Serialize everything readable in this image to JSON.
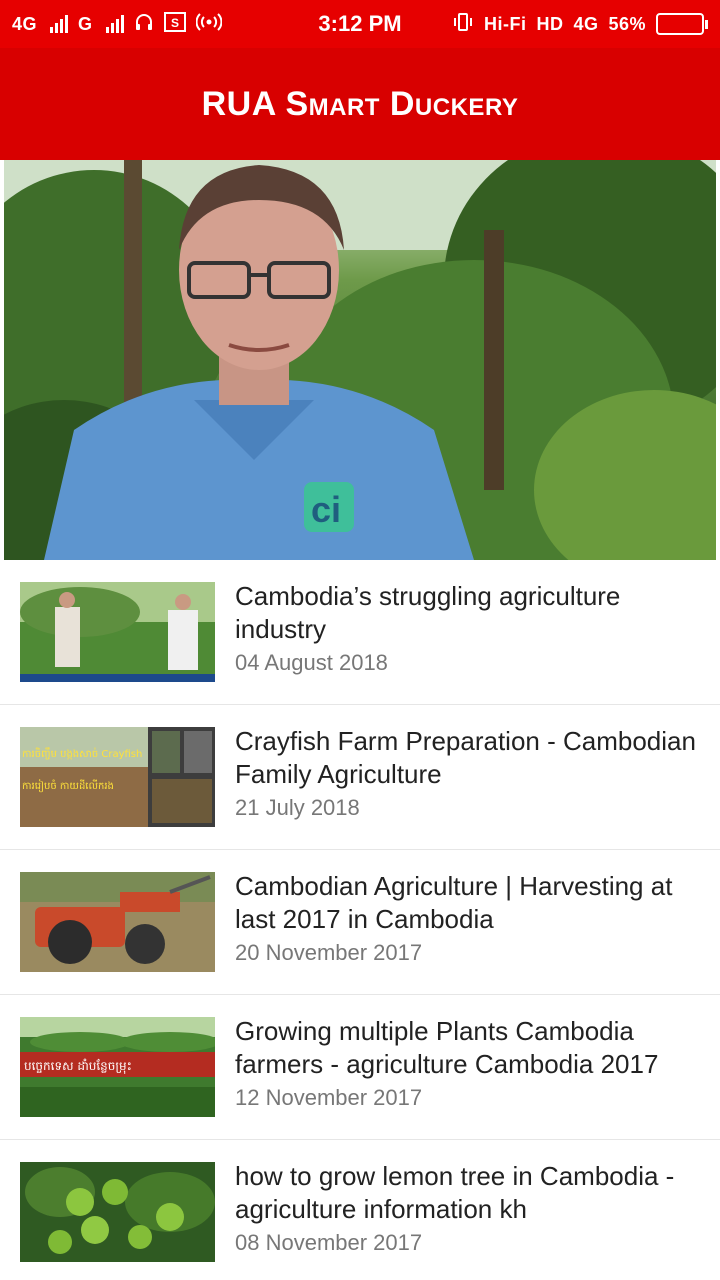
{
  "status_bar": {
    "left_network_1": "4G",
    "left_network_2": "G",
    "headphone_icon": "headphones-icon",
    "sim_icon": "sim-icon",
    "hotspot_icon": "hotspot-icon",
    "time": "3:12 PM",
    "vibrate_icon": "vibrate-icon",
    "hifi": "Hi-Fi",
    "hd": "HD",
    "right_network": "4G",
    "battery_text": "56%",
    "battery_level": 0.56
  },
  "app": {
    "title": "RUA Smart Duckery",
    "accent_color": "#d80000"
  },
  "video": {
    "logo_text": "ci"
  },
  "feed": {
    "items": [
      {
        "title": "Cambodia’s struggling agriculture industry",
        "date": "04 August 2018"
      },
      {
        "title": "Crayfish Farm Preparation - Cambodian Family Agriculture",
        "date": "21 July 2018",
        "thumb_text_1": "ការចិញ្ចឹម បង្កងសាច់ Crayfish",
        "thumb_text_2": "ការរៀបចំ កាយដីលើករង"
      },
      {
        "title": "Cambodian Agriculture | Harvesting at last 2017 in Cambodia",
        "date": "20 November 2017"
      },
      {
        "title": "Growing multiple Plants Cambodia farmers - agriculture Cambodia 2017",
        "date": "12 November 2017",
        "thumb_text_1": "បច្ចេកទេស ដាំបន្លែចម្រុះ"
      },
      {
        "title": "how to grow lemon tree in Cambodia - agriculture information kh",
        "date": "08 November 2017"
      }
    ]
  }
}
